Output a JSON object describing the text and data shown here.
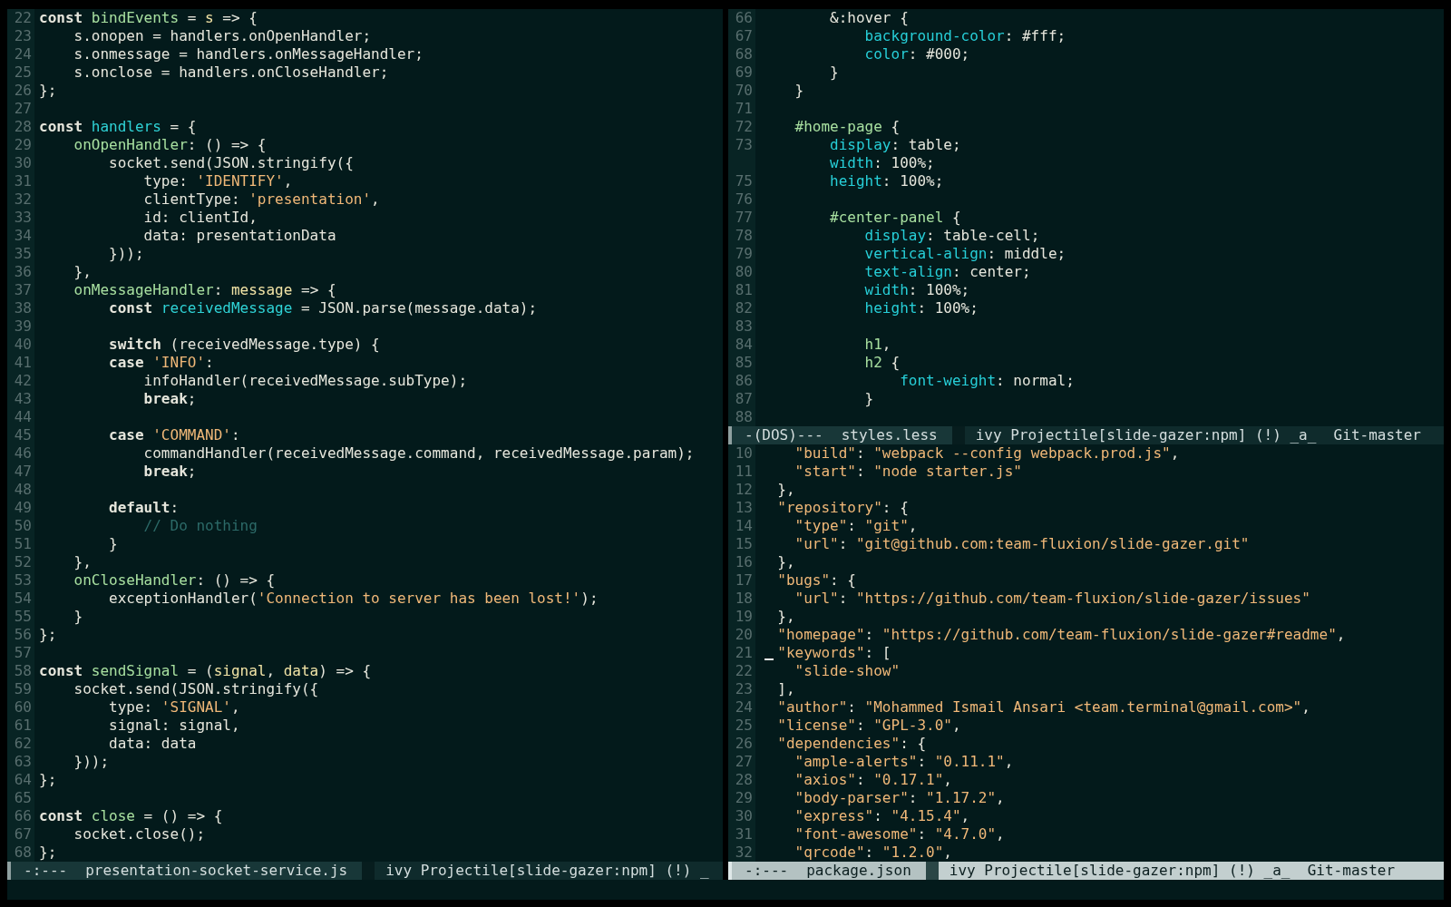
{
  "windows": [
    {
      "active": false,
      "lines": [
        {
          "number": "22",
          "tokens": [
            {
              "kind": "keyword",
              "text": "const "
            },
            {
              "kind": "function",
              "text": "bindEvents"
            },
            " = ",
            {
              "kind": "param",
              "text": "s"
            },
            " => {"
          ]
        },
        {
          "number": "23",
          "tokens": [
            "    s.onopen = handlers.onOpenHandler;"
          ]
        },
        {
          "number": "24",
          "tokens": [
            "    s.onmessage = handlers.onMessageHandler;"
          ]
        },
        {
          "number": "25",
          "tokens": [
            "    s.onclose = handlers.onCloseHandler;"
          ]
        },
        {
          "number": "26",
          "tokens": [
            "};"
          ]
        },
        {
          "number": "27"
        },
        {
          "number": "28",
          "tokens": [
            {
              "kind": "keyword",
              "text": "const "
            },
            {
              "kind": "variable",
              "text": "handlers"
            },
            " = {"
          ]
        },
        {
          "number": "29",
          "tokens": [
            {
              "kind": "function",
              "text": "    onOpenHandler"
            },
            ": () => {"
          ]
        },
        {
          "number": "30",
          "tokens": [
            "        socket.send(JSON.stringify({"
          ]
        },
        {
          "number": "31",
          "tokens": [
            "            type: ",
            {
              "kind": "string",
              "text": "'IDENTIFY'"
            },
            ","
          ]
        },
        {
          "number": "32",
          "tokens": [
            "            clientType: ",
            {
              "kind": "string",
              "text": "'presentation'"
            },
            ","
          ]
        },
        {
          "number": "33",
          "tokens": [
            "            id: clientId,"
          ]
        },
        {
          "number": "34",
          "tokens": [
            "            data: presentationData"
          ]
        },
        {
          "number": "35",
          "tokens": [
            "        }));"
          ]
        },
        {
          "number": "36",
          "tokens": [
            "    },"
          ]
        },
        {
          "number": "37",
          "tokens": [
            {
              "kind": "function",
              "text": "    onMessageHandler"
            },
            ": ",
            {
              "kind": "param",
              "text": "message"
            },
            " => {"
          ]
        },
        {
          "number": "38",
          "tokens": [
            {
              "kind": "keyword",
              "text": "        const "
            },
            {
              "kind": "variable",
              "text": "receivedMessage"
            },
            " = JSON.parse(message.data);"
          ]
        },
        {
          "number": "39"
        },
        {
          "number": "40",
          "tokens": [
            {
              "kind": "keyword",
              "text": "        switch"
            },
            " (receivedMessage.type) {"
          ]
        },
        {
          "number": "41",
          "tokens": [
            {
              "kind": "keyword",
              "text": "        case "
            },
            {
              "kind": "string",
              "text": "'INFO'"
            },
            ":"
          ]
        },
        {
          "number": "42",
          "tokens": [
            "            infoHandler(receivedMessage.subType);"
          ]
        },
        {
          "number": "43",
          "tokens": [
            {
              "kind": "keyword",
              "text": "            break"
            },
            ";"
          ]
        },
        {
          "number": "44"
        },
        {
          "number": "45",
          "tokens": [
            {
              "kind": "keyword",
              "text": "        case "
            },
            {
              "kind": "string",
              "text": "'COMMAND'"
            },
            ":"
          ]
        },
        {
          "number": "46",
          "tokens": [
            "            commandHandler(receivedMessage.command, receivedMessage.param);"
          ]
        },
        {
          "number": "47",
          "tokens": [
            {
              "kind": "keyword",
              "text": "            break"
            },
            ";"
          ]
        },
        {
          "number": "48"
        },
        {
          "number": "49",
          "tokens": [
            {
              "kind": "keyword",
              "text": "        default"
            },
            ":"
          ]
        },
        {
          "number": "50",
          "tokens": [
            {
              "kind": "comment",
              "text": "            // Do nothing"
            }
          ]
        },
        {
          "number": "51",
          "tokens": [
            "        }"
          ]
        },
        {
          "number": "52",
          "tokens": [
            "    },"
          ]
        },
        {
          "number": "53",
          "tokens": [
            {
              "kind": "function",
              "text": "    onCloseHandler"
            },
            ": () => {"
          ]
        },
        {
          "number": "54",
          "tokens": [
            "        exceptionHandler(",
            {
              "kind": "string",
              "text": "'Connection to server has been lost!'"
            },
            ");"
          ]
        },
        {
          "number": "55",
          "tokens": [
            "    }"
          ]
        },
        {
          "number": "56",
          "tokens": [
            "};"
          ]
        },
        {
          "number": "57"
        },
        {
          "number": "58",
          "tokens": [
            {
              "kind": "keyword",
              "text": "const "
            },
            {
              "kind": "function",
              "text": "sendSignal"
            },
            " = (",
            {
              "kind": "param",
              "text": "signal"
            },
            ", ",
            {
              "kind": "param",
              "text": "data"
            },
            ") => {"
          ]
        },
        {
          "number": "59",
          "tokens": [
            "    socket.send(JSON.stringify({"
          ]
        },
        {
          "number": "60",
          "tokens": [
            "        type: ",
            {
              "kind": "string",
              "text": "'SIGNAL'"
            },
            ","
          ]
        },
        {
          "number": "61",
          "tokens": [
            "        signal: signal,"
          ]
        },
        {
          "number": "62",
          "tokens": [
            "        data: data"
          ]
        },
        {
          "number": "63",
          "tokens": [
            "    }));"
          ]
        },
        {
          "number": "64",
          "tokens": [
            "};"
          ]
        },
        {
          "number": "65"
        },
        {
          "number": "66",
          "tokens": [
            {
              "kind": "keyword",
              "text": "const "
            },
            {
              "kind": "function",
              "text": "close"
            },
            " = () => {"
          ]
        },
        {
          "number": "67",
          "tokens": [
            "    socket.close();"
          ]
        },
        {
          "number": "68",
          "tokens": [
            "};"
          ]
        }
      ],
      "mode_line": {
        "state": "-:---",
        "buffer": "presentation-socket-service.js",
        "modes": "ivy Projectile[slide-gazer:npm] (!) _"
      }
    },
    {
      "active": false,
      "lines": [
        {
          "number": "66",
          "tokens": [
            "        &:hover {"
          ]
        },
        {
          "number": "67",
          "tokens": [
            {
              "kind": "property",
              "text": "            background-color"
            },
            ": #fff;"
          ]
        },
        {
          "number": "68",
          "tokens": [
            {
              "kind": "property",
              "text": "            color"
            },
            ": #000;"
          ]
        },
        {
          "number": "69",
          "tokens": [
            "        }"
          ]
        },
        {
          "number": "70",
          "tokens": [
            "    }"
          ]
        },
        {
          "number": "71"
        },
        {
          "number": "72",
          "tokens": [
            {
              "kind": "selector",
              "text": "    #home-page"
            },
            " {"
          ]
        },
        {
          "number": "73",
          "tokens": [
            {
              "kind": "property",
              "text": "        display"
            },
            ": table;"
          ]
        },
        {
          "tokens": [
            {
              "kind": "property",
              "text": "        width"
            },
            ": 100%;"
          ]
        },
        {
          "number": "75",
          "tokens": [
            {
              "kind": "property",
              "text": "        height"
            },
            ": 100%;"
          ]
        },
        {
          "number": "76"
        },
        {
          "number": "77",
          "tokens": [
            {
              "kind": "selector",
              "text": "        #center-panel"
            },
            " {"
          ]
        },
        {
          "number": "78",
          "tokens": [
            {
              "kind": "property",
              "text": "            display"
            },
            ": table-cell;"
          ]
        },
        {
          "number": "79",
          "tokens": [
            {
              "kind": "property",
              "text": "            vertical-align"
            },
            ": middle;"
          ]
        },
        {
          "number": "80",
          "tokens": [
            {
              "kind": "property",
              "text": "            text-align"
            },
            ": center;"
          ]
        },
        {
          "number": "81",
          "tokens": [
            {
              "kind": "property",
              "text": "            width"
            },
            ": 100%;"
          ]
        },
        {
          "number": "82",
          "tokens": [
            {
              "kind": "property",
              "text": "            height"
            },
            ": 100%;"
          ]
        },
        {
          "number": "83"
        },
        {
          "number": "84",
          "tokens": [
            {
              "kind": "selector",
              "text": "            h1"
            },
            ","
          ]
        },
        {
          "number": "85",
          "tokens": [
            {
              "kind": "selector",
              "text": "            h2"
            },
            " {"
          ]
        },
        {
          "number": "86",
          "tokens": [
            {
              "kind": "property",
              "text": "                font-weight"
            },
            ": normal;"
          ]
        },
        {
          "number": "87",
          "tokens": [
            "            }"
          ]
        },
        {
          "number": "88"
        }
      ],
      "mode_line": {
        "state": "-(DOS)---",
        "buffer": "styles.less",
        "modes": "ivy Projectile[slide-gazer:npm] (!) _a_  Git-master"
      }
    },
    {
      "active": true,
      "lines": [
        {
          "number": "10",
          "cursor": false,
          "tokens": [
            {
              "kind": "string",
              "text": "    \"build\""
            },
            ": ",
            {
              "kind": "string",
              "text": "\"webpack --config webpack.prod.js\""
            },
            ","
          ]
        },
        {
          "number": "11",
          "cursor": false,
          "tokens": [
            {
              "kind": "string",
              "text": "    \"start\""
            },
            ": ",
            {
              "kind": "string",
              "text": "\"node starter.js\""
            }
          ]
        },
        {
          "number": "12",
          "cursor": false,
          "tokens": [
            "  },"
          ]
        },
        {
          "number": "13",
          "cursor": false,
          "tokens": [
            {
              "kind": "string",
              "text": "  \"repository\""
            },
            ": {"
          ]
        },
        {
          "number": "14",
          "cursor": false,
          "tokens": [
            {
              "kind": "string",
              "text": "    \"type\""
            },
            ": ",
            {
              "kind": "string",
              "text": "\"git\""
            },
            ","
          ]
        },
        {
          "number": "15",
          "cursor": false,
          "tokens": [
            {
              "kind": "string",
              "text": "    \"url\""
            },
            ": ",
            {
              "kind": "string",
              "text": "\"git@github.com:team-fluxion/slide-gazer.git\""
            }
          ]
        },
        {
          "number": "16",
          "cursor": false,
          "tokens": [
            "  },"
          ]
        },
        {
          "number": "17",
          "cursor": false,
          "tokens": [
            {
              "kind": "string",
              "text": "  \"bugs\""
            },
            ": {"
          ]
        },
        {
          "number": "18",
          "cursor": false,
          "tokens": [
            {
              "kind": "string",
              "text": "    \"url\""
            },
            ": ",
            {
              "kind": "string",
              "text": "\"https://github.com/team-fluxion/slide-gazer/issues\""
            }
          ]
        },
        {
          "number": "19",
          "cursor": false,
          "tokens": [
            "  },"
          ]
        },
        {
          "number": "20",
          "cursor": false,
          "tokens": [
            {
              "kind": "string",
              "text": "  \"homepage\""
            },
            ": ",
            {
              "kind": "string",
              "text": "\"https://github.com/team-fluxion/slide-gazer#readme\""
            },
            ","
          ]
        },
        {
          "number": "21",
          "cursor": true,
          "tokens": [
            {
              "kind": "string",
              "text": "  \"keywords\""
            },
            ": ["
          ]
        },
        {
          "number": "22",
          "cursor": false,
          "tokens": [
            {
              "kind": "string",
              "text": "    \"slide-show\""
            }
          ]
        },
        {
          "number": "23",
          "cursor": false,
          "tokens": [
            "  ],"
          ]
        },
        {
          "number": "24",
          "cursor": false,
          "tokens": [
            {
              "kind": "string",
              "text": "  \"author\""
            },
            ": ",
            {
              "kind": "string",
              "text": "\"Mohammed Ismail Ansari <team.terminal@gmail.com>\""
            },
            ","
          ]
        },
        {
          "number": "25",
          "cursor": false,
          "tokens": [
            {
              "kind": "string",
              "text": "  \"license\""
            },
            ": ",
            {
              "kind": "string",
              "text": "\"GPL-3.0\""
            },
            ","
          ]
        },
        {
          "number": "26",
          "cursor": false,
          "tokens": [
            {
              "kind": "string",
              "text": "  \"dependencies\""
            },
            ": {"
          ]
        },
        {
          "number": "27",
          "cursor": false,
          "tokens": [
            {
              "kind": "string",
              "text": "    \"ample-alerts\""
            },
            ": ",
            {
              "kind": "string",
              "text": "\"0.11.1\""
            },
            ","
          ]
        },
        {
          "number": "28",
          "cursor": false,
          "tokens": [
            {
              "kind": "string",
              "text": "    \"axios\""
            },
            ": ",
            {
              "kind": "string",
              "text": "\"0.17.1\""
            },
            ","
          ]
        },
        {
          "number": "29",
          "cursor": false,
          "tokens": [
            {
              "kind": "string",
              "text": "    \"body-parser\""
            },
            ": ",
            {
              "kind": "string",
              "text": "\"1.17.2\""
            },
            ","
          ]
        },
        {
          "number": "30",
          "cursor": false,
          "tokens": [
            {
              "kind": "string",
              "text": "    \"express\""
            },
            ": ",
            {
              "kind": "string",
              "text": "\"4.15.4\""
            },
            ","
          ]
        },
        {
          "number": "31",
          "cursor": false,
          "tokens": [
            {
              "kind": "string",
              "text": "    \"font-awesome\""
            },
            ": ",
            {
              "kind": "string",
              "text": "\"4.7.0\""
            },
            ","
          ]
        },
        {
          "number": "32",
          "cursor": false,
          "tokens": [
            {
              "kind": "string",
              "text": "    \"qrcode\""
            },
            ": ",
            {
              "kind": "string",
              "text": "\"1.2.0\""
            },
            ","
          ]
        }
      ],
      "mode_line": {
        "state": "-:---",
        "buffer": "package.json",
        "modes": "ivy Projectile[slide-gazer:npm] (!) _a_  Git-master"
      }
    }
  ]
}
